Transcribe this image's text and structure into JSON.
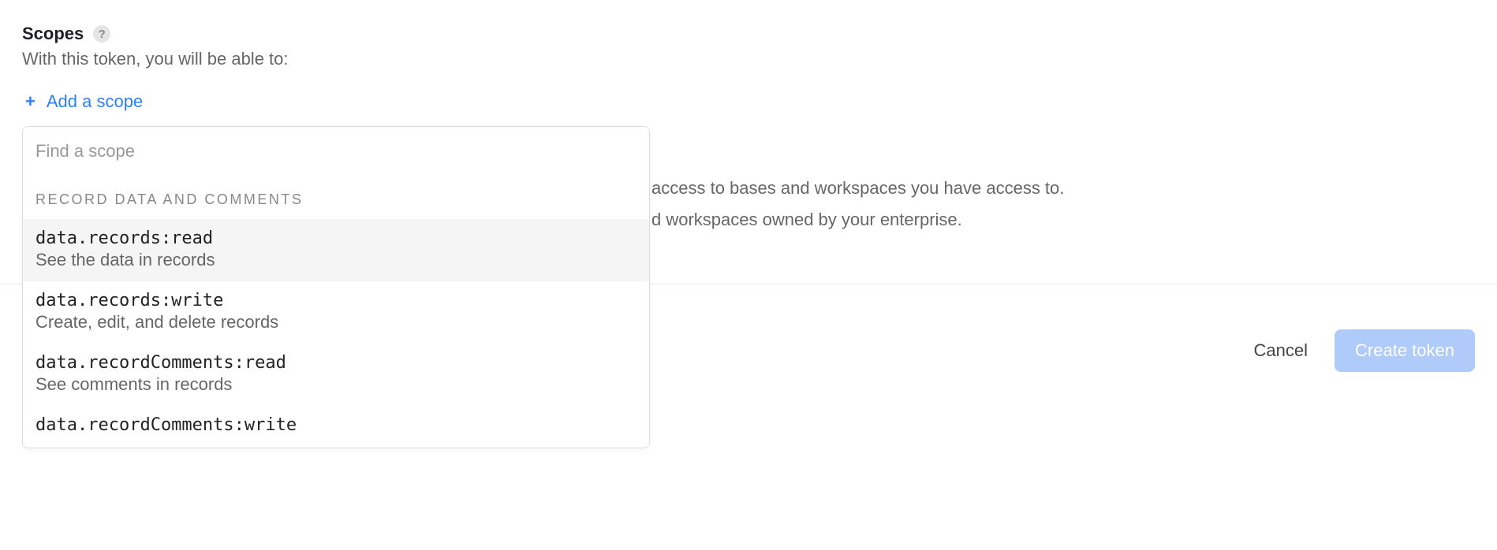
{
  "scopes": {
    "title": "Scopes",
    "subtitle": "With this token, you will be able to:",
    "add_label": "Add a scope",
    "search_placeholder": "Find a scope",
    "group_header": "RECORD DATA AND COMMENTS",
    "items": [
      {
        "name": "data.records:read",
        "desc": "See the data in records",
        "highlighted": true
      },
      {
        "name": "data.records:write",
        "desc": "Create, edit, and delete records",
        "highlighted": false
      },
      {
        "name": "data.recordComments:read",
        "desc": "See comments in records",
        "highlighted": false
      },
      {
        "name": "data.recordComments:write",
        "desc": "",
        "highlighted": false
      }
    ]
  },
  "background": {
    "line1": "access to bases and workspaces you have access to.",
    "line2": "d workspaces owned by your enterprise."
  },
  "footer": {
    "cancel": "Cancel",
    "create": "Create token"
  }
}
